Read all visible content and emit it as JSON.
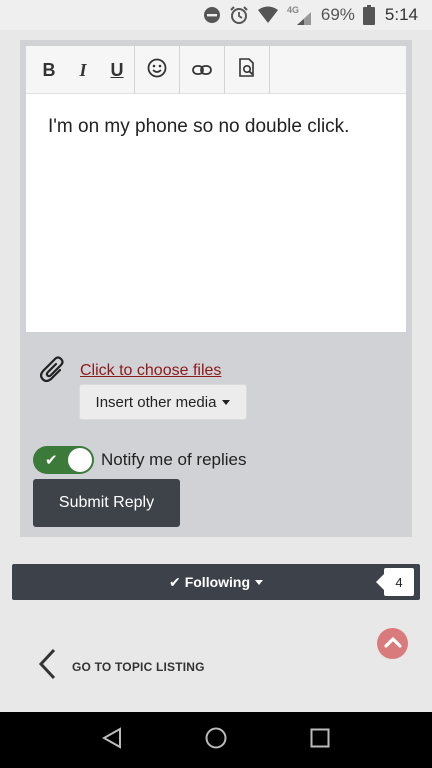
{
  "status_bar": {
    "battery_percent": "69%",
    "time": "5:14",
    "icons": [
      "do-not-disturb-icon",
      "alarm-icon",
      "wifi-icon",
      "lte-signal-icon",
      "battery-icon"
    ]
  },
  "editor": {
    "toolbar": {
      "bold_label": "B",
      "italic_label": "I",
      "underline_label": "U",
      "icons": [
        "emoji-icon",
        "link-icon",
        "preview-icon"
      ]
    },
    "content": "I'm on my phone so no double click."
  },
  "attachments": {
    "link_label": "Click to choose files",
    "media_button_label": "Insert other media"
  },
  "notify": {
    "label": "Notify me of replies",
    "enabled": true
  },
  "submit": {
    "label": "Submit Reply"
  },
  "following": {
    "label": "Following",
    "count": "4"
  },
  "go_to_topic": {
    "label": "GO TO TOPIC LISTING"
  },
  "colors": {
    "accent_red": "#8b1a1a",
    "toggle_green": "#3b7a39",
    "dark_button": "#3e4249",
    "back_to_top": "#d97b7c"
  }
}
